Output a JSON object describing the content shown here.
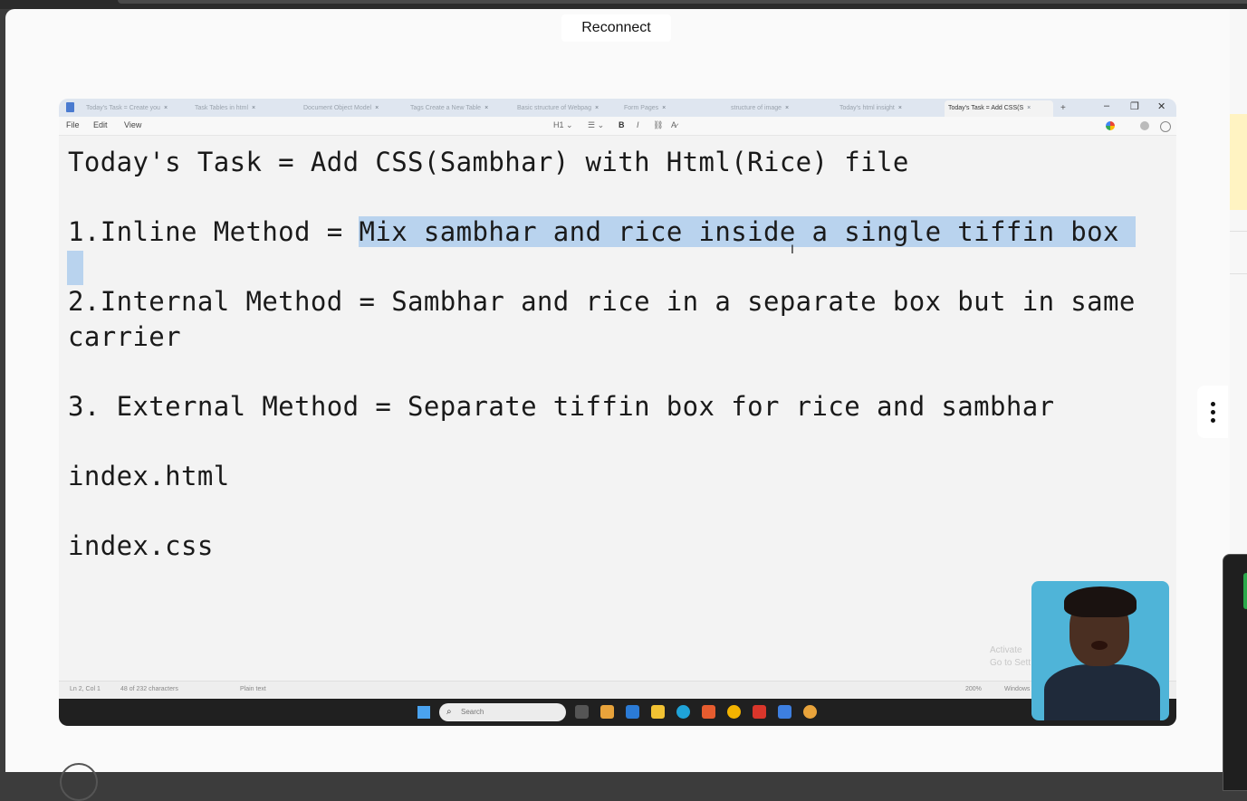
{
  "overlay": {
    "reconnect_label": "Reconnect"
  },
  "notepad": {
    "tabs": [
      {
        "label": "Today's Task = Create you",
        "active": false
      },
      {
        "label": "Task Tables in html",
        "active": false
      },
      {
        "label": "Document Object Model",
        "active": false
      },
      {
        "label": "Tags Create a New Table",
        "active": false
      },
      {
        "label": "Basic structure of Webpag",
        "active": false
      },
      {
        "label": "Form Pages",
        "active": false
      },
      {
        "label": "structure of image",
        "active": false
      },
      {
        "label": "Today's html insight",
        "active": false
      },
      {
        "label": "Today's Task = Add CSS(S",
        "active": true
      }
    ],
    "tab_close": "×",
    "new_tab": "+",
    "window_controls": {
      "minimize": "–",
      "maximize": "❐",
      "close": "✕"
    },
    "menu": {
      "file": "File",
      "edit": "Edit",
      "view": "View"
    },
    "format_toolbar": {
      "heading": "H1 ⌄",
      "list": "☰ ⌄",
      "bold": "B",
      "italic": "I",
      "link": "⛓",
      "clear": "A̷"
    },
    "lines": {
      "l1": "Today's Task = Add CSS(Sambhar) with Html(Rice) file",
      "l2_prefix": "1.Inline Method = ",
      "l2_selected": "Mix sambhar and rice inside a single tiffin box ",
      "l3": "2.Internal Method = Sambhar and rice in a separate box but in same",
      "l4": "carrier",
      "l5": "3. External Method = Separate tiffin box for rice and sambhar",
      "l6": "index.html",
      "l7": "index.css"
    },
    "status": {
      "position": "Ln 2, Col 1",
      "chars": "48 of 232 characters",
      "format": "Plain text",
      "zoom": "200%",
      "line_ending": "Windows (CRLF)"
    },
    "watermark": {
      "line1": "Activate",
      "line2": "Go to Sett"
    }
  },
  "taskbar": {
    "search_placeholder": "Search"
  },
  "colors": {
    "selection": "#b9d3ee",
    "tabbar": "#dfe6f0",
    "taskbar": "#202020"
  }
}
